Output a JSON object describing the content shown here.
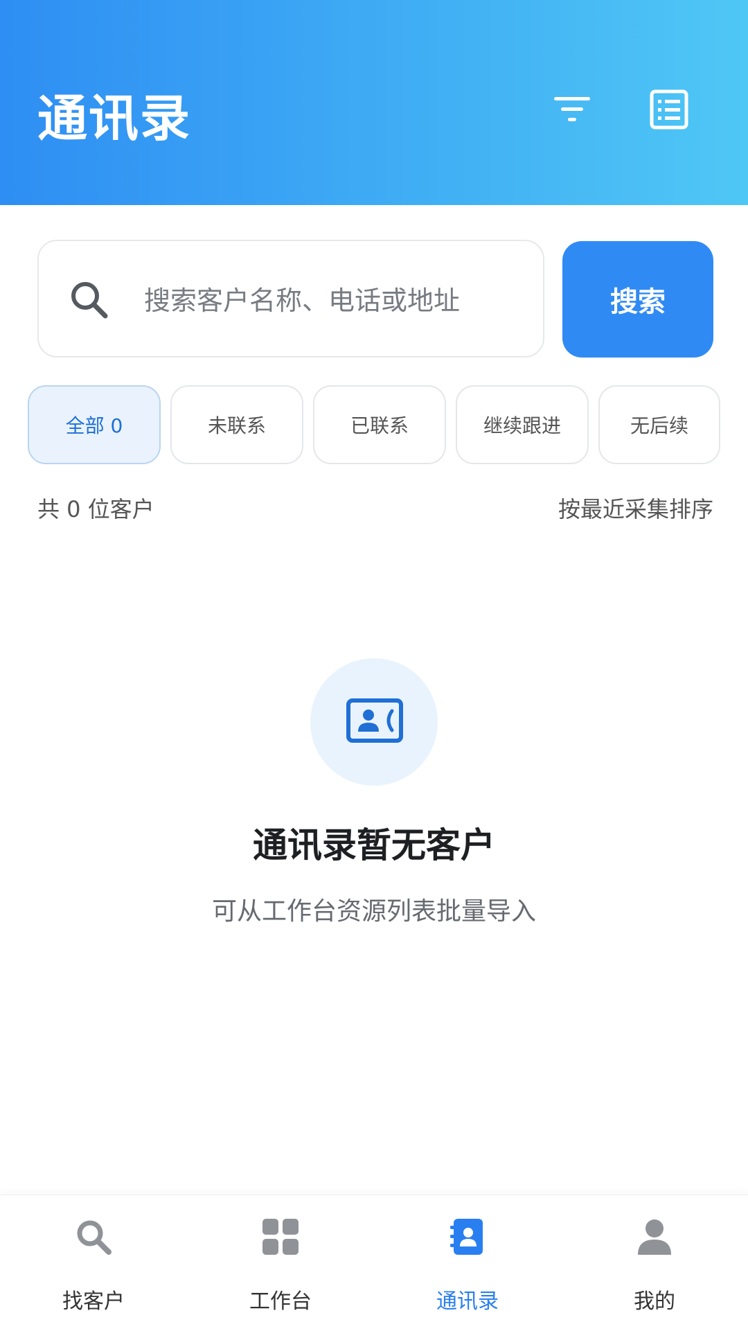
{
  "header": {
    "title": "通讯录",
    "filter_icon": "filter-icon",
    "list_icon": "list-icon"
  },
  "search": {
    "placeholder": "搜索客户名称、电话或地址",
    "value": "",
    "button_label": "搜索"
  },
  "tabs": [
    {
      "label": "全部 0",
      "active": true
    },
    {
      "label": "未联系",
      "active": false
    },
    {
      "label": "已联系",
      "active": false
    },
    {
      "label": "继续跟进",
      "active": false
    },
    {
      "label": "无后续",
      "active": false
    }
  ],
  "summary": {
    "count_text": "共 0 位客户",
    "sort_label": "按最近采集排序"
  },
  "empty_state": {
    "icon": "contact-card-icon",
    "title": "通讯录暂无客户",
    "subtitle": "可从工作台资源列表批量导入"
  },
  "bottom_nav": [
    {
      "label": "找客户",
      "icon": "search-icon",
      "active": false
    },
    {
      "label": "工作台",
      "icon": "grid-icon",
      "active": false
    },
    {
      "label": "通讯录",
      "icon": "contacts-book-icon",
      "active": true
    },
    {
      "label": "我的",
      "icon": "user-icon",
      "active": false
    }
  ],
  "colors": {
    "header_gradient_start": "#2e8ef3",
    "header_gradient_end": "#4fc7f5",
    "primary": "#2f8af4",
    "active_tab_bg": "#eaf3fd",
    "nav_active": "#2a7ff0",
    "nav_inactive_icon": "#8f9297"
  }
}
